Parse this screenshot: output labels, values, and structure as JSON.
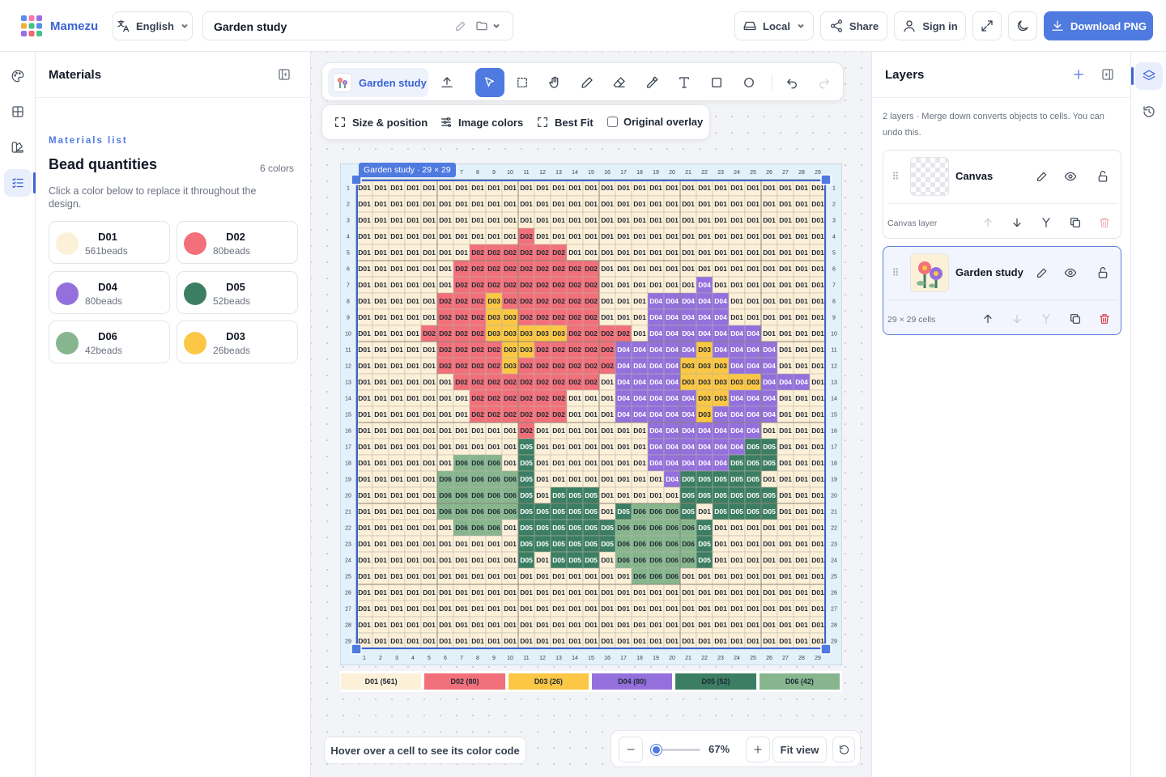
{
  "app": {
    "name": "Mamezu"
  },
  "header": {
    "language": "English",
    "project_title": "Garden study",
    "storage": "Local",
    "share_label": "Share",
    "signin_label": "Sign in",
    "download_label": "Download PNG"
  },
  "left_rail": {
    "items": [
      "palette-icon",
      "grid-icon",
      "swatches-icon",
      "checklist-icon"
    ],
    "active": 3
  },
  "materials": {
    "panel_title": "Materials",
    "eyebrow": "Materials list",
    "heading": "Bead quantities",
    "color_count": "6 colors",
    "hint": "Click a color below to replace it throughout the design.",
    "colors": [
      {
        "code": "D01",
        "count": "561beads",
        "hex": "#fdf0d8"
      },
      {
        "code": "D02",
        "count": "80beads",
        "hex": "#f2707a"
      },
      {
        "code": "D04",
        "count": "80beads",
        "hex": "#9470dc"
      },
      {
        "code": "D05",
        "count": "52beads",
        "hex": "#3c7e63"
      },
      {
        "code": "D06",
        "count": "42beads",
        "hex": "#87b68e"
      },
      {
        "code": "D03",
        "count": "26beads",
        "hex": "#fbc745"
      }
    ]
  },
  "toolbar": {
    "layer_chip": "Garden study",
    "tools": [
      "upload-icon",
      "select-icon",
      "marquee-icon",
      "hand-icon",
      "pencil-icon",
      "eraser-icon",
      "eyedropper-icon",
      "text-icon",
      "rectangle-icon",
      "circle-icon",
      "undo-icon",
      "redo-icon"
    ]
  },
  "subbar": {
    "size_position": "Size & position",
    "image_colors": "Image colors",
    "best_fit": "Best Fit",
    "original_overlay": "Original overlay"
  },
  "chart_data": {
    "type": "heatmap",
    "title": "Garden study",
    "selection_label": "Garden study · 29 × 29",
    "cols": 29,
    "rows": 29,
    "palette": {
      "D01": "#fdf0d8",
      "D02": "#f2707a",
      "D03": "#fbc745",
      "D04": "#9470dc",
      "D05": "#3c7e63",
      "D06": "#87b68e"
    },
    "grid": [
      "11111111111111111111111111111",
      "11111111111111111111111111111",
      "11111111111111111111111111111",
      "11111111112111111111111111111",
      "11111112222221111111111111111",
      "11111122222222211111111111111",
      "11111122222222211111141111111",
      "11111222322222211144444111111",
      "11111222332222211144444111111",
      "11112222333332222144444441111",
      "11111222233222224444434444111",
      "11111222232222224444333444111",
      "11111122222222214444333334441",
      "11111112222221114444433444111",
      "11111112222221114444434444111",
      "11111111112111111144444441111",
      "11111111115111111144444455111",
      "11111166615111111144444555111",
      "11111666665111111114555551111",
      "11111666665155511111555555111",
      "11111666665555515666515555111",
      "11111166615555556666651111111",
      "11111111115555556666651111111",
      "11111111115155516666651111111",
      "11111111111111111666111111111",
      "11111111111111111111111111111",
      "11111111111111111111111111111",
      "11111111111111111111111111111",
      "11111111111111111111111111111"
    ],
    "legend": [
      "D01 (561)",
      "D02 (80)",
      "D03 (26)",
      "D04 (80)",
      "D05 (52)",
      "D06 (42)"
    ]
  },
  "status": {
    "hover_hint": "Hover over a cell to see its color code"
  },
  "zoom": {
    "level": 0.67,
    "label": "67%",
    "fit_label": "Fit view"
  },
  "layers": {
    "panel_title": "Layers",
    "info": "2 layers · Merge down converts objects to cells. You can undo this.",
    "items": [
      {
        "name": "Canvas",
        "sub": "Canvas layer"
      },
      {
        "name": "Garden study",
        "sub": "29 × 29 cells"
      }
    ]
  }
}
